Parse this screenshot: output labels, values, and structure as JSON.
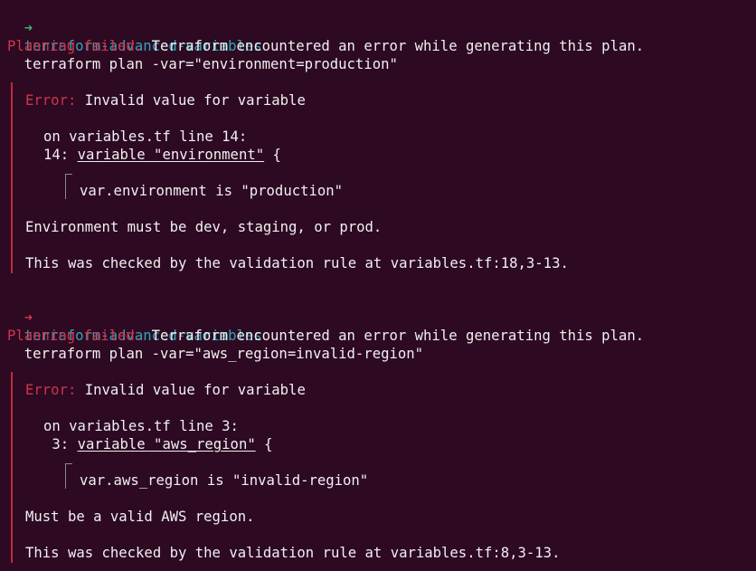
{
  "blocks": [
    {
      "prompt_arrow": "➜",
      "prompt_dir": "terraform-advanced-variables",
      "prompt_cmd": "terraform plan -var=\"environment=production\"",
      "fail_label": "Planning failed.",
      "fail_msg": " Terraform encountered an error while generating this plan.",
      "error_label": "Error:",
      "error_summary": " Invalid value for variable",
      "location": "on variables.tf line 14:",
      "line_no": "14: ",
      "code_decl": "variable \"environment\"",
      "code_rest": " {",
      "value_line": "var.environment is \"production\"",
      "message": "Environment must be dev, staging, or prod.",
      "checked": "This was checked by the validation rule at variables.tf:18,3-13."
    },
    {
      "prompt_arrow": "➜",
      "prompt_dir": "terraform-advanced-variables",
      "prompt_cmd": "terraform plan -var=\"aws_region=invalid-region\"",
      "fail_label": "Planning failed.",
      "fail_msg": " Terraform encountered an error while generating this plan.",
      "error_label": "Error:",
      "error_summary": " Invalid value for variable",
      "location": "on variables.tf line 3:",
      "line_no": " 3: ",
      "code_decl": "variable \"aws_region\"",
      "code_rest": " {",
      "value_line": "var.aws_region is \"invalid-region\"",
      "message": "Must be a valid AWS region.",
      "checked": "This was checked by the validation rule at variables.tf:8,3-13."
    }
  ],
  "colors": {
    "background": "#2d0922",
    "prompt_arrow_ok": "#3fae7a",
    "prompt_arrow_err": "#d0344a",
    "directory": "#2ea6b8",
    "error": "#d0344a"
  }
}
